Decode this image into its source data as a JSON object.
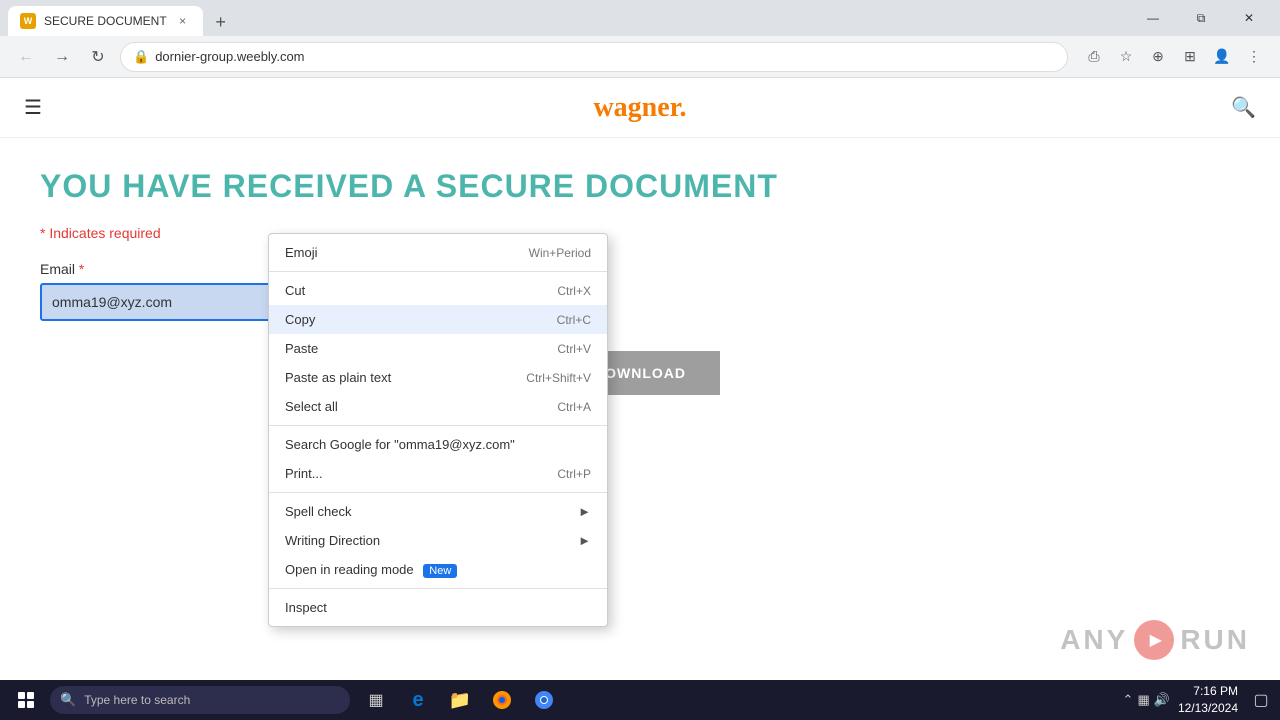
{
  "browser": {
    "tab": {
      "favicon": "W",
      "title": "SECURE DOCUMENT",
      "close_label": "×"
    },
    "new_tab_label": "+",
    "window_controls": {
      "minimize": "—",
      "maximize": "⧉",
      "close": "✕"
    },
    "nav": {
      "back_disabled": true,
      "forward_disabled": false,
      "reload": "↻"
    },
    "url": "dornier-group.weebly.com",
    "toolbar_icons": [
      "⎙",
      "★",
      "⊕",
      "⊞",
      "👤",
      "⋮"
    ]
  },
  "site": {
    "logo": "wagner.",
    "header_title": "YOU HAVE RECEIVED A SECURE DOCUMENT",
    "indicates_required": "* Indicates required",
    "email_label": "Email",
    "email_required": true,
    "email_value": "omma19@xyz.com",
    "download_label": "DOWNLOAD"
  },
  "context_menu": {
    "items": [
      {
        "label": "Emoji",
        "shortcut": "Win+Period",
        "has_submenu": false
      },
      {
        "label": "Cut",
        "shortcut": "Ctrl+X",
        "has_submenu": false
      },
      {
        "label": "Copy",
        "shortcut": "Ctrl+C",
        "has_submenu": false,
        "highlighted": true
      },
      {
        "label": "Paste",
        "shortcut": "Ctrl+V",
        "has_submenu": false
      },
      {
        "label": "Paste as plain text",
        "shortcut": "Ctrl+Shift+V",
        "has_submenu": false
      },
      {
        "label": "Select all",
        "shortcut": "Ctrl+A",
        "has_submenu": false
      },
      {
        "label": "Search Google for \"omma19@xyz.com\"",
        "shortcut": "",
        "has_submenu": false
      },
      {
        "label": "Print...",
        "shortcut": "Ctrl+P",
        "has_submenu": false
      },
      {
        "label": "Spell check",
        "shortcut": "",
        "has_submenu": true
      },
      {
        "label": "Writing Direction",
        "shortcut": "",
        "has_submenu": true
      },
      {
        "label": "Open in reading mode",
        "shortcut": "",
        "has_submenu": false,
        "badge": "New"
      },
      {
        "label": "Inspect",
        "shortcut": "",
        "has_submenu": false
      }
    ]
  },
  "watermark": {
    "text_left": "ANY",
    "text_right": "RUN"
  },
  "taskbar": {
    "search_placeholder": "Type here to search",
    "clock_time": "7:16 PM",
    "clock_date": "12/13/2024",
    "apps": [
      "task-view",
      "edge",
      "folder",
      "firefox",
      "chrome"
    ]
  }
}
